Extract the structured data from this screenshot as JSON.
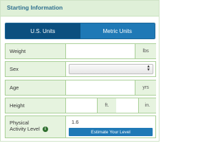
{
  "section": {
    "title": "Starting Information"
  },
  "unit_tabs": [
    {
      "label": "U.S. Units",
      "active": true
    },
    {
      "label": "Metric Units",
      "active": false
    }
  ],
  "fields": {
    "weight": {
      "label": "Weight",
      "value": "",
      "unit": "lbs"
    },
    "sex": {
      "label": "Sex",
      "selected": ""
    },
    "age": {
      "label": "Age",
      "value": "",
      "unit": "yrs"
    },
    "height": {
      "label": "Height",
      "feet_value": "",
      "feet_unit": "ft.",
      "inches_value": "",
      "inches_unit": "in."
    },
    "activity": {
      "label_line1": "Physical",
      "label_line2": "Activity Level",
      "info_icon": "info-icon",
      "value": "1.6",
      "button_label": "Estimate Your Level"
    }
  },
  "colors": {
    "header_bg": "#dff0d8",
    "header_text": "#2e6f8e",
    "tab_active": "#0b4f7f",
    "tab_inactive": "#1f79b6",
    "label_bg": "#e6f3df",
    "border": "#a8cf95",
    "button": "#1f79b6"
  }
}
